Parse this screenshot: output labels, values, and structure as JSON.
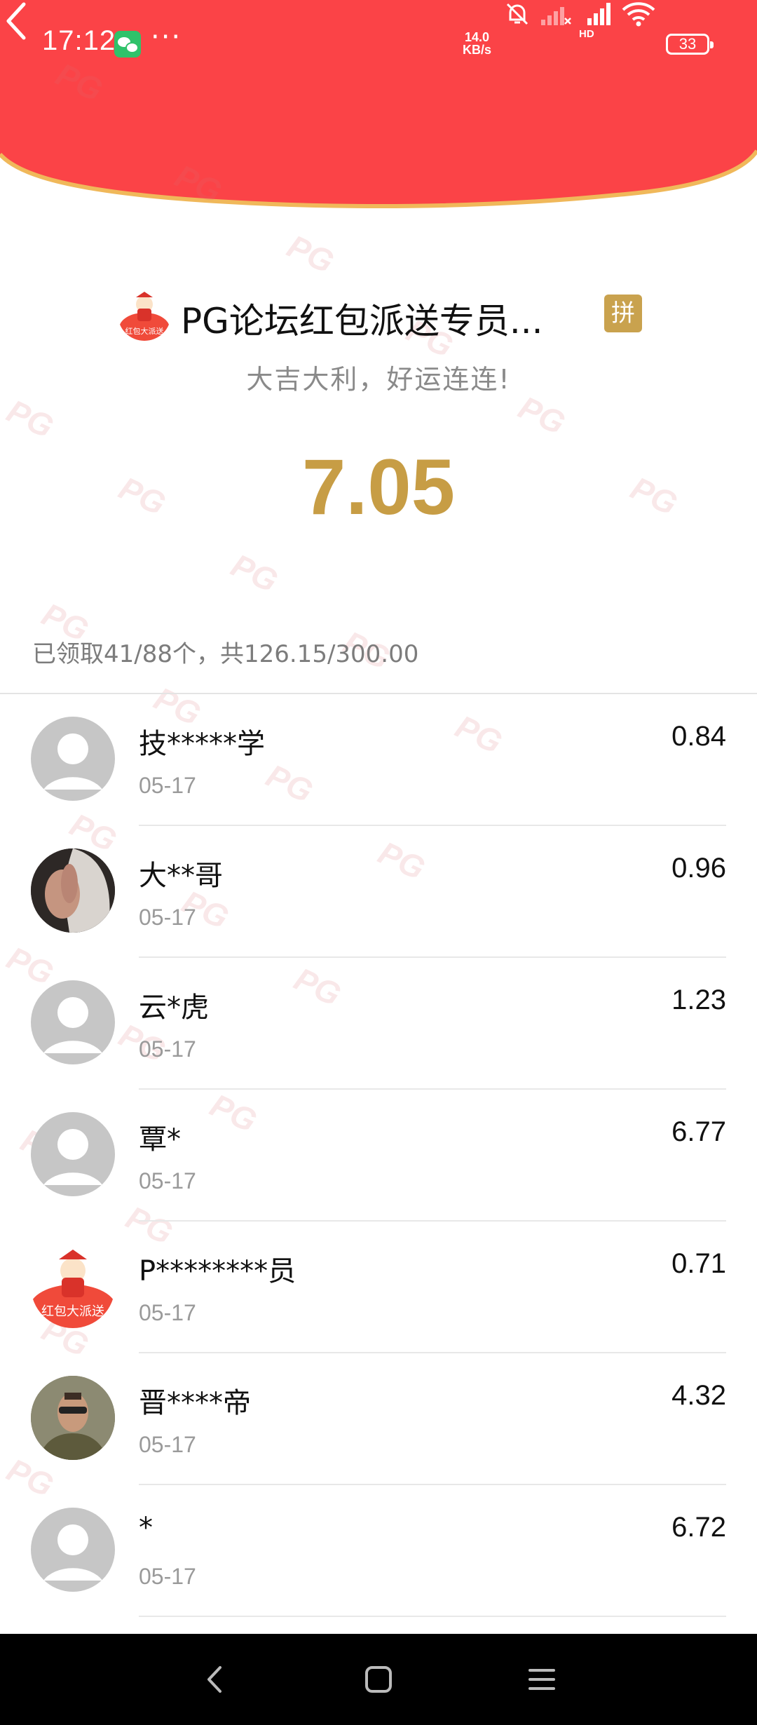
{
  "status_bar": {
    "time": "17:12",
    "dots": "···",
    "net_speed_value": "14.0",
    "net_speed_unit": "KB/s",
    "hd_label": "HD",
    "battery": "33"
  },
  "colors": {
    "header_red": "#fb4347",
    "gold": "#c79d45"
  },
  "packet": {
    "sender_name": "PG论坛红包派送专员...",
    "badge": "拼",
    "sender_avatar_text": "红包大派送",
    "blessing": "大吉大利，好运连连!",
    "amount": "7.05",
    "summary": "已领取41/88个，共126.15/300.00"
  },
  "records": [
    {
      "name": "技*****学",
      "date": "05-17",
      "amount": "0.84",
      "avatar": "default-avatar"
    },
    {
      "name": "大**哥",
      "date": "05-17",
      "amount": "0.96",
      "avatar": "photo-avatar"
    },
    {
      "name": "云*虎",
      "date": "05-17",
      "amount": "1.23",
      "avatar": "default-avatar"
    },
    {
      "name": "覃*",
      "date": "05-17",
      "amount": "6.77",
      "avatar": "default-avatar"
    },
    {
      "name": "P********员",
      "date": "05-17",
      "amount": "0.71",
      "avatar": "red-packet-avatar"
    },
    {
      "name": "晋****帝",
      "date": "05-17",
      "amount": "4.32",
      "avatar": "photo-avatar"
    },
    {
      "name": "*",
      "date": "05-17",
      "amount": "6.72",
      "avatar": "default-avatar"
    }
  ],
  "watermark": "PG",
  "nav": {
    "back": "back-nav-icon",
    "home": "home-nav-icon",
    "menu": "menu-nav-icon"
  }
}
